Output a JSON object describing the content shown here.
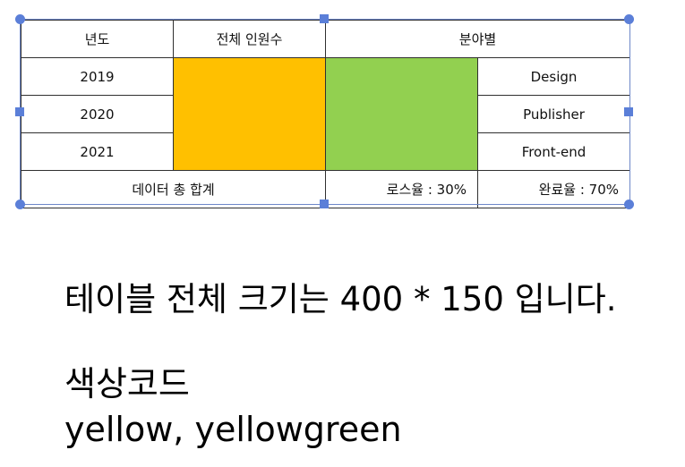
{
  "table": {
    "header": {
      "year": "년도",
      "total_people": "전체 인원수",
      "by_field": "분야별"
    },
    "rows": [
      {
        "year": "2019",
        "field": "Design"
      },
      {
        "year": "2020",
        "field": "Publisher"
      },
      {
        "year": "2021",
        "field": "Front-end"
      }
    ],
    "footer": {
      "total_label": "데이터 총 합계",
      "loss_rate": "로스율 : 30%",
      "completion_rate": "완료율 : 70%"
    },
    "cell_colors": {
      "total_people_cell": "#FFC000",
      "by_field_cell": "#92D050"
    }
  },
  "selection": {
    "frame_color": "#6E87C9",
    "handle_color": "#5B7FD8"
  },
  "captions": {
    "size_note": "테이블 전체 크기는 400 * 150 입니다.",
    "color_code_title": "색상코드",
    "color_code_values": "yellow, yellowgreen"
  }
}
